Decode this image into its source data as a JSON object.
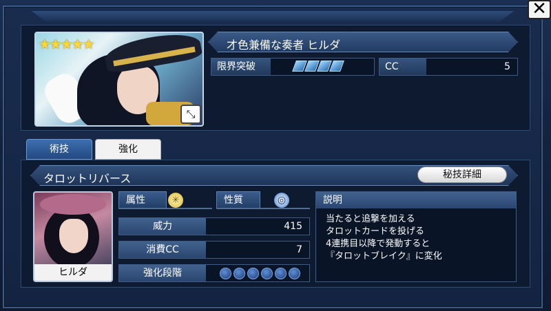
{
  "window": {
    "close_label": "✕"
  },
  "card": {
    "rarity_stars": "★★★★★",
    "title": "才色兼備な奏者 ヒルダ",
    "limit_break_label": "限界突破",
    "limit_break_level": 4,
    "cc_label": "CC",
    "cc_value": "5",
    "expand_icon": "⤡"
  },
  "tabs": [
    {
      "label": "術技"
    },
    {
      "label": "強化"
    }
  ],
  "skill": {
    "name": "タロットリバース",
    "detail_button": "秘技詳細",
    "character_name": "ヒルダ",
    "attribute_label": "属性",
    "attribute_icon": "light-element-icon",
    "nature_label": "性質",
    "nature_icon": "wave-icon",
    "power_label": "威力",
    "power_value": "415",
    "cc_cost_label": "消費CC",
    "cc_cost_value": "7",
    "enhance_label": "強化段階",
    "enhance_level": 0,
    "enhance_max": 6,
    "description_label": "説明",
    "description_lines": [
      "当たると追撃を加える",
      "タロットカードを投げる",
      "4連携目以降で発動すると",
      "『タロットブレイク』に変化"
    ]
  },
  "colors": {
    "accent": "#3d6fb0",
    "star": "#ffd63a",
    "background": "#14233f"
  }
}
